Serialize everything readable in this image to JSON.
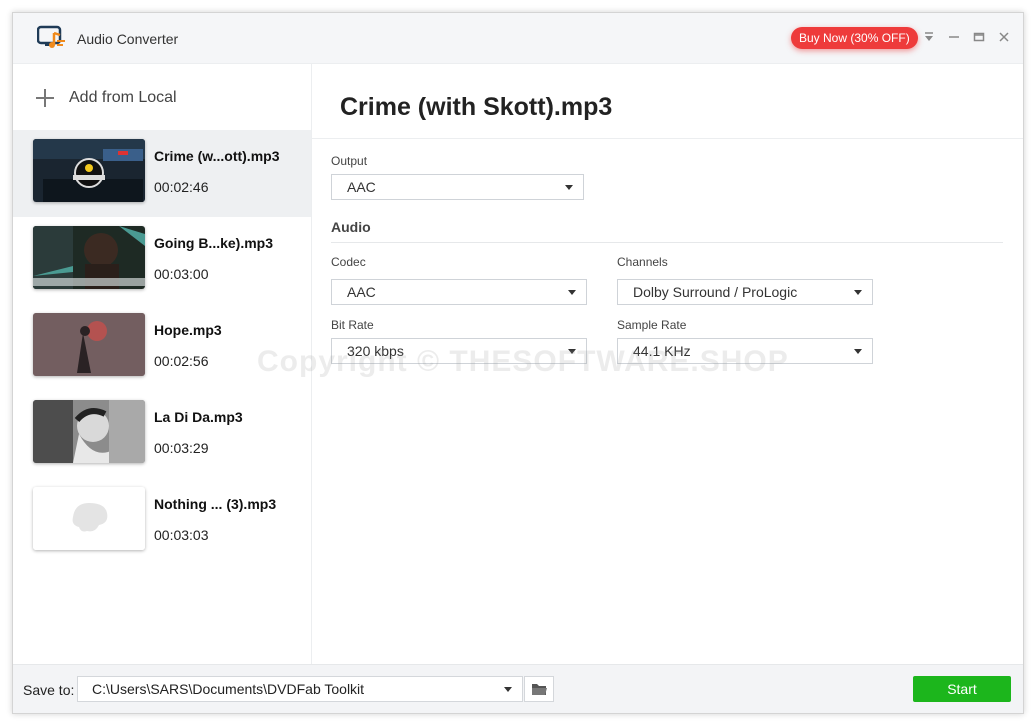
{
  "app": {
    "title": "Audio Converter",
    "buy_label": "Buy Now (30% OFF)",
    "accent_color": "#ee3b3b"
  },
  "sidebar": {
    "add_label": "Add from Local",
    "files": [
      {
        "name": "Crime (w...ott).mp3",
        "duration": "00:02:46",
        "selected": true
      },
      {
        "name": "Going B...ke).mp3",
        "duration": "00:03:00",
        "selected": false
      },
      {
        "name": "Hope.mp3",
        "duration": "00:02:56",
        "selected": false
      },
      {
        "name": "La Di Da.mp3",
        "duration": "00:03:29",
        "selected": false
      },
      {
        "name": "Nothing ... (3).mp3",
        "duration": "00:03:03",
        "selected": false
      }
    ]
  },
  "main": {
    "title": "Crime (with Skott).mp3",
    "output_label": "Output",
    "output_value": "AAC",
    "audio_section": "Audio",
    "codec_label": "Codec",
    "codec_value": "AAC",
    "channels_label": "Channels",
    "channels_value": "Dolby Surround / ProLogic",
    "bitrate_label": "Bit Rate",
    "bitrate_value": "320 kbps",
    "samplerate_label": "Sample Rate",
    "samplerate_value": "44.1 KHz",
    "watermark": "Copyright © THESOFTWARE.SHOP"
  },
  "footer": {
    "save_label": "Save to:",
    "save_path": "C:\\Users\\SARS\\Documents\\DVDFab Toolkit",
    "start_label": "Start",
    "start_color": "#1cb61c"
  }
}
